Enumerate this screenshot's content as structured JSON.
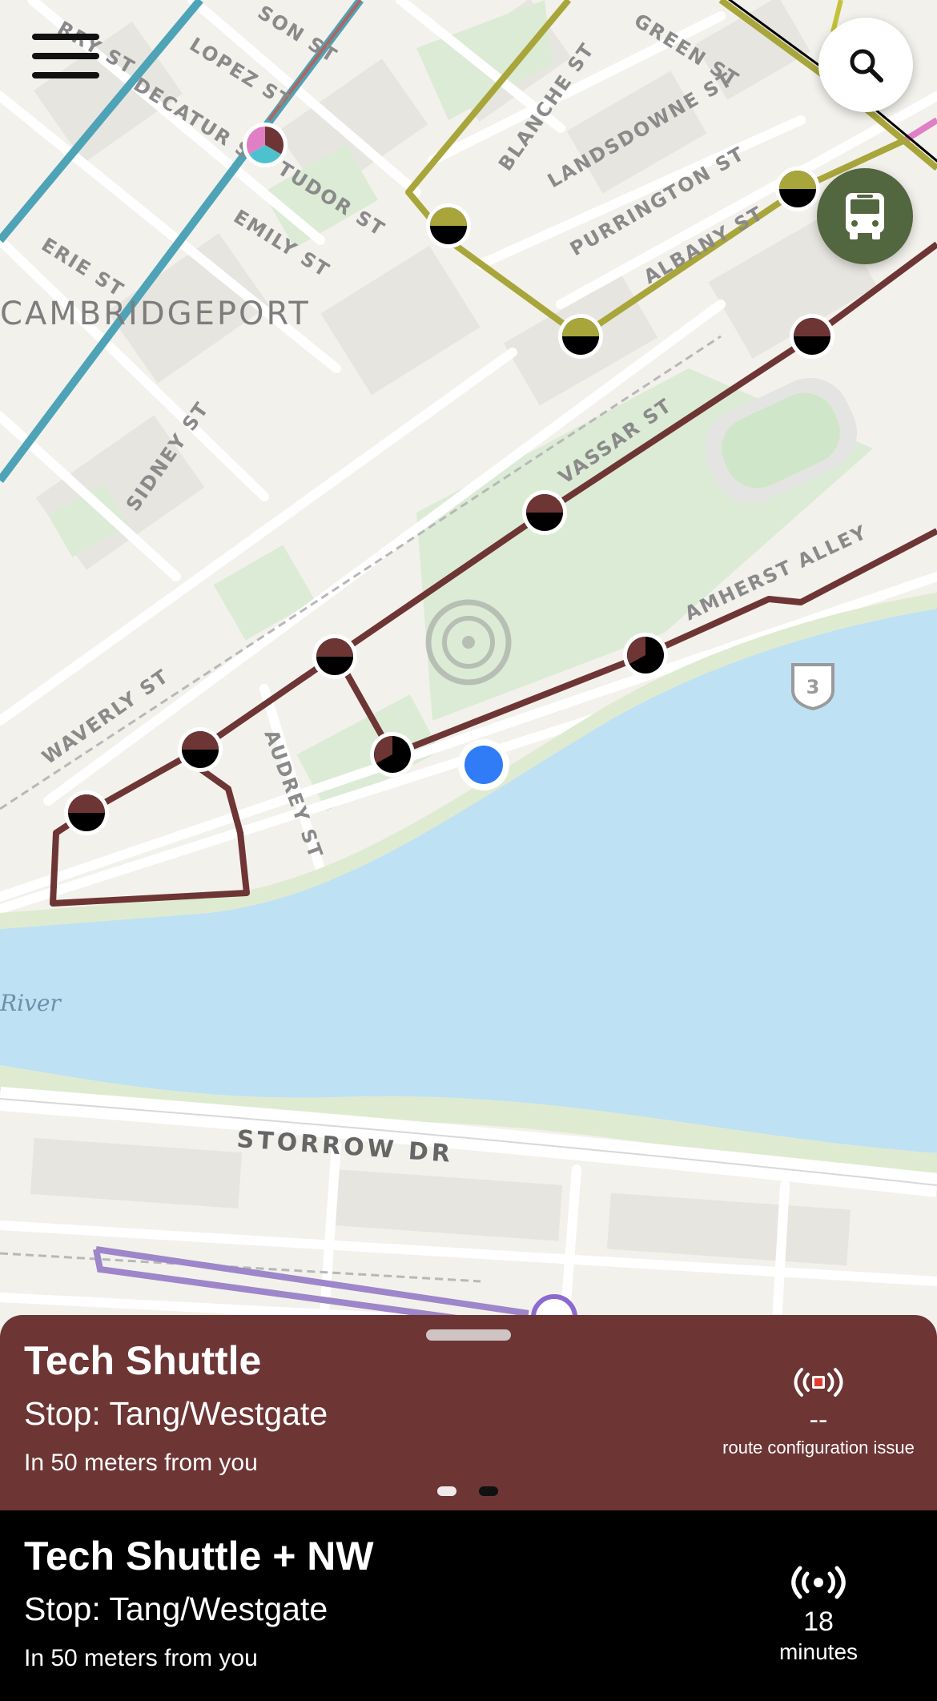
{
  "map": {
    "district": "CAMBRIDGEPORT",
    "river": "River",
    "road": "STORROW DR",
    "highway_shield": "3",
    "streets": [
      "RRY ST",
      "SON ST",
      "LOPEZ ST",
      "DECATUR ST",
      "TUDOR ST",
      "EMILY ST",
      "ERIE ST",
      "SIDNEY ST",
      "WAVERLY ST",
      "AUDREY ST",
      "GREEN ST",
      "BLANCHE ST",
      "LANDSDOWNE ST",
      "PURRINGTON ST",
      "ALBANY ST",
      "VASSAR ST",
      "AMHERST ALLEY"
    ],
    "colors": {
      "tech_shuttle": "#6e3535",
      "northwest": "#a8a63a",
      "user_location": "#2f7cf6",
      "water": "#bfe1f4"
    }
  },
  "controls": {
    "menu_icon": "hamburger-menu-icon",
    "search_icon": "magnifier-icon",
    "bus_icon": "bus-icon"
  },
  "cards": [
    {
      "route": "Tech Shuttle",
      "stop": "Stop: Tang/Westgate",
      "distance": "In 50 meters from you",
      "eta": "--",
      "eta_note": "route configuration issue",
      "status_icon": "broadcast-error-icon",
      "color": "#6e3535"
    },
    {
      "route": "Tech Shuttle + NW",
      "stop": "Stop: Tang/Westgate",
      "distance": "In 50 meters from you",
      "eta": "18",
      "eta_unit": "minutes",
      "status_icon": "broadcast-live-icon",
      "color": "#000000"
    }
  ],
  "pager": {
    "pages": 2,
    "current": 1
  }
}
